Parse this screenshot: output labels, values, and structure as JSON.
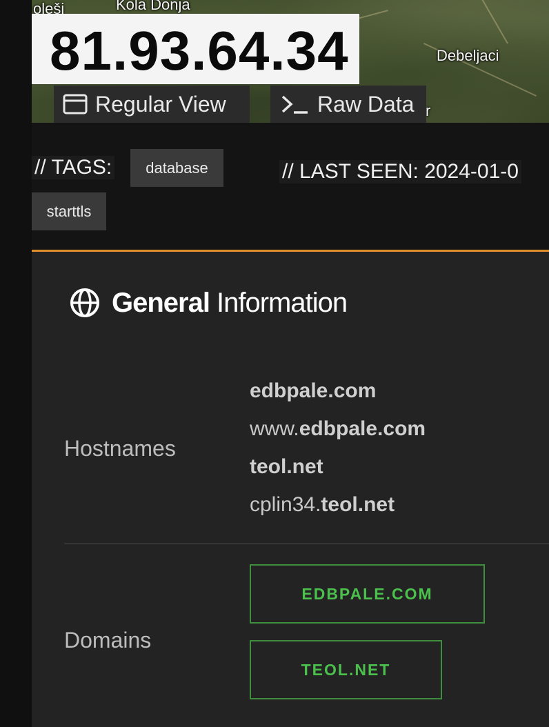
{
  "map": {
    "labels": [
      "oleši",
      "Kola Donja",
      "Debeljaci",
      "r"
    ]
  },
  "header": {
    "ip": "81.93.64.34",
    "regular_view": "Regular View",
    "raw_data": "Raw Data",
    "regular_view_icon": "browser-window-icon",
    "raw_data_icon": "terminal-icon"
  },
  "tags": {
    "label": "// TAGS:",
    "items": [
      "database",
      "starttls"
    ]
  },
  "last_seen": {
    "text": "// LAST SEEN: 2024-01-0"
  },
  "general": {
    "title_bold": "General",
    "title_rest": "Information",
    "icon": "globe-icon",
    "accent_color": "#e0902a",
    "hostnames_label": "Hostnames",
    "hostnames": [
      {
        "prefix": "",
        "bold": "edbpale.com"
      },
      {
        "prefix": "www.",
        "bold": "edbpale.com"
      },
      {
        "prefix": "",
        "bold": "teol.net"
      },
      {
        "prefix": "cplin34.",
        "bold": "teol.net"
      }
    ],
    "domains_label": "Domains",
    "domains": [
      "EDBPALE.COM",
      "TEOL.NET"
    ],
    "domain_color": "#4cc04c"
  }
}
